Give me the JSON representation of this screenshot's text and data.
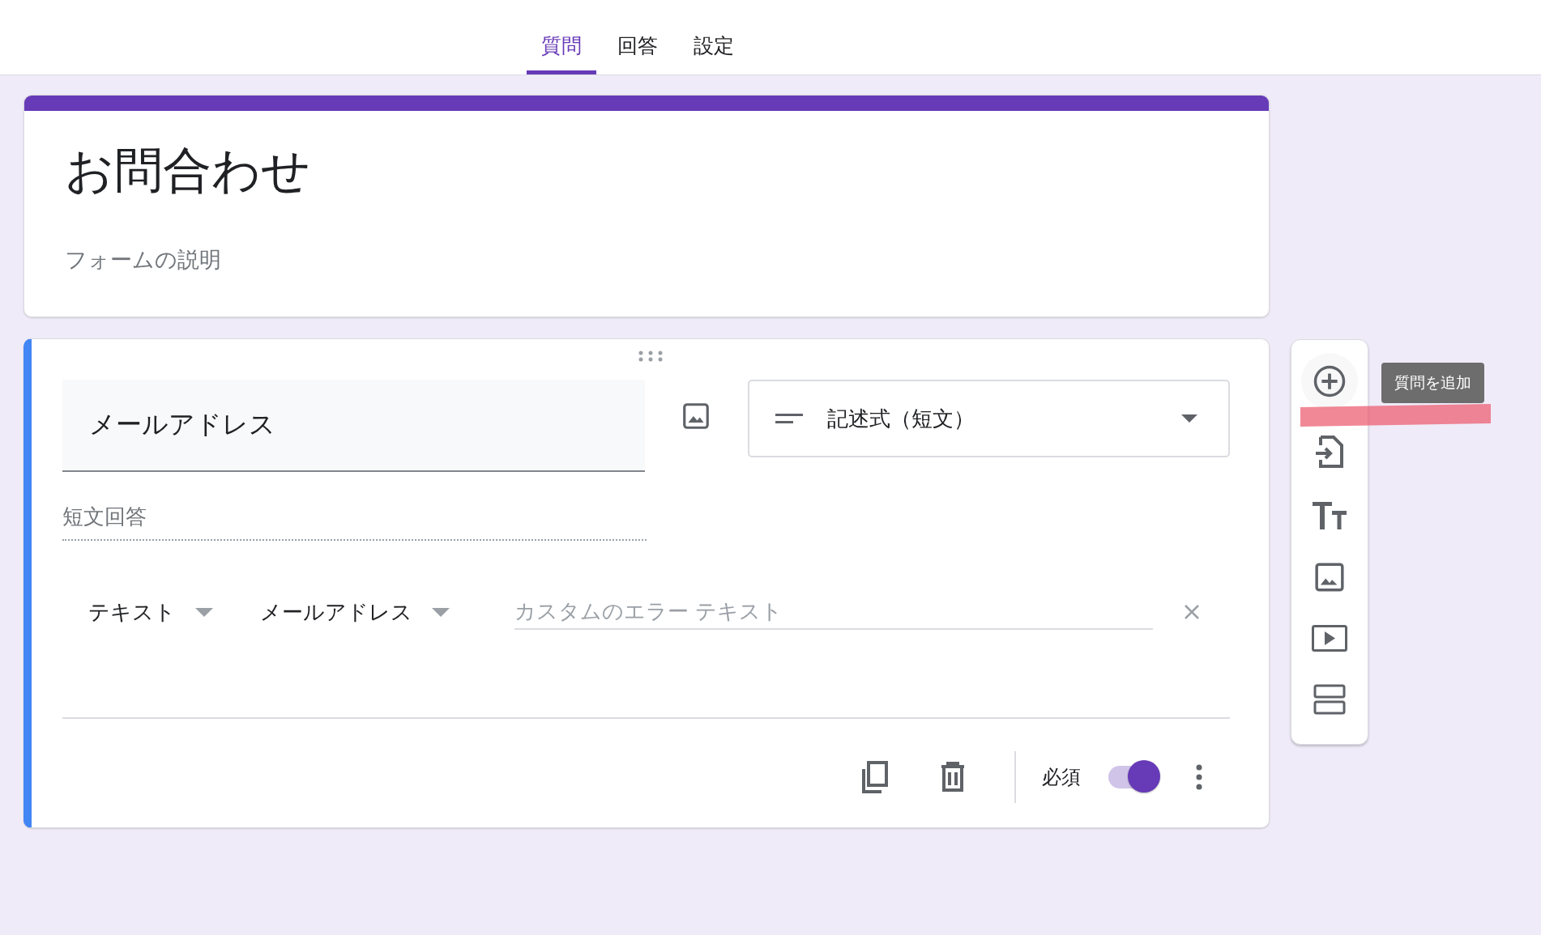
{
  "tabs": [
    {
      "label": "質問",
      "selected": true
    },
    {
      "label": "回答",
      "selected": false
    },
    {
      "label": "設定",
      "selected": false
    }
  ],
  "form": {
    "title": "お問合わせ",
    "description": "フォームの説明"
  },
  "question": {
    "title": "メールアドレス",
    "type_label": "記述式（短文）",
    "answer_placeholder": "短文回答",
    "validation": {
      "type": "テキスト",
      "condition": "メールアドレス",
      "error_placeholder": "カスタムのエラー テキスト"
    },
    "required_label": "必須",
    "required": true
  },
  "tooltip": "質問を追加"
}
